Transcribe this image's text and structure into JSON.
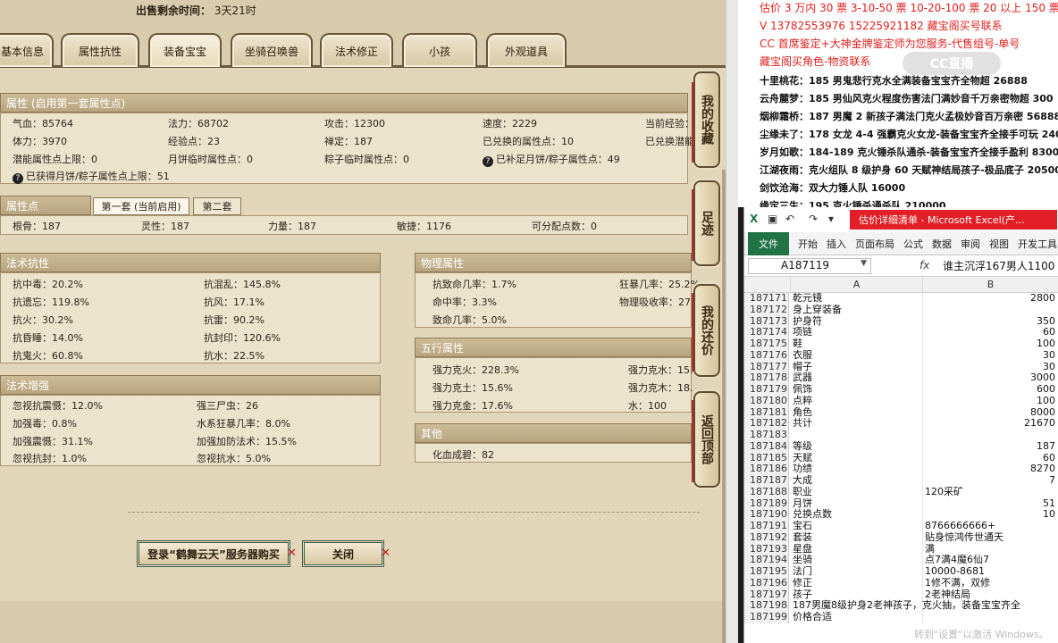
{
  "game": {
    "sale_time_label": "出售剩余时间：",
    "sale_time_value": "3天21时",
    "tabs": [
      "基本信息",
      "属性抗性",
      "装备宝宝",
      "坐骑召唤兽",
      "法术修正",
      "小孩",
      "外观道具"
    ],
    "active_tab": "装备宝宝",
    "attr_header": "属性 (启用第一套属性点)",
    "attrs": {
      "qixue": "气血：85764",
      "fali": "法力：68702",
      "gongji": "攻击：12300",
      "sudu": "速度：2229",
      "dangqian": "当前经验：",
      "tili": "体力：3970",
      "jingyan": "经验点：23",
      "chanding": "禅定：187",
      "yiduihuan": "已兑换的属性点：10",
      "yiduihuan_qian": "已兑换潜能",
      "qianneng": "潜能属性点上限：0",
      "yuebing": "月饼临时属性点：0",
      "zongzi": "粽子临时属性点：0",
      "yibuzu": "已补足月饼/粽子属性点：49",
      "yihuode": "已获得月饼/粽子属性点上限：51"
    },
    "shuxingdian_header": "属性点",
    "subtabs": [
      "第一套 (当前启用)",
      "第二套"
    ],
    "points": {
      "gengu": "根骨：187",
      "lingxing": "灵性：187",
      "liliang": "力量：187",
      "minjie": "敏捷：1176",
      "kefenpei": "可分配点数：0"
    },
    "fashu_kangxing_header": "法术抗性",
    "fashu_kangxing": [
      "抗中毒：20.2%",
      "抗混乱：145.8%",
      "抗遗忘：119.8%",
      "抗风：17.1%",
      "抗火：30.2%",
      "抗雷：90.2%",
      "抗昏睡：14.0%",
      "抗封印：120.6%",
      "抗鬼火：60.8%",
      "抗水：22.5%"
    ],
    "fashu_zengqiang_header": "法术增强",
    "fashu_zengqiang": [
      "忽视抗震慑：12.0%",
      "强三尸虫：26",
      "加强毒：0.8%",
      "水系狂暴几率：8.0%",
      "加强震慑：31.1%",
      "加强加防法术：15.5%",
      "忽视抗封：1.0%",
      "忽视抗水：5.0%"
    ],
    "wuli_header": "物理属性",
    "wuli": [
      "抗致命几率：1.7%",
      "狂暴几率：25.2%",
      "命中率：3.3%",
      "物理吸收率：27.",
      "致命几率：5.0%"
    ],
    "wuxing_header": "五行属性",
    "wuxing": [
      "强力克火：228.3%",
      "强力克水：15.",
      "强力克土：15.6%",
      "强力克木：18.",
      "强力克金：17.6%",
      "水：100"
    ],
    "qita_header": "其他",
    "qita": [
      "化血成碧：82"
    ],
    "side_buttons": [
      "我的收藏",
      "足迹",
      "我的还价",
      "返回顶部"
    ],
    "btn_login": "登录“鹤舞云天”服务器购买",
    "btn_close": "关闭"
  },
  "doc": {
    "lines": [
      "估价 3 万内 30 票  3-10-50 票  10-20-100 票  20 以上 150 票-1 票 1",
      "V 13782553976    15225921182   藏宝阁买号联系",
      "CC 首席鉴定+大神金牌鉴定师为您服务-代售组号-单号",
      "藏宝阁买角色-物资联系",
      "十里桃花：185 男鬼悲行克水全满装备宝宝齐全物超 26888",
      "云舟麓梦：185 男仙风克火程度伤害法门满妙音千万亲密物超 300",
      "烟柳霜桥：187 男魔 2 新孩子满法门克火孟极妙音百万亲密 56888",
      "尘缘未了：178 女龙 4-4 强霸克火女龙-装备宝宝齐全接手可玩 240",
      "岁月如歌：184-189 克火锤杀队通杀-装备宝宝齐全接手盈利 8300",
      "江湖夜雨：克火组队 8 级护身 60 天赋神结局孩子-极品底子 20500",
      "剑饮沧海：双大力锤人队 16000",
      "缘定三生：195 克火锤杀通杀队 210000"
    ],
    "watermark": "CC直播"
  },
  "excel": {
    "title": "估价详细清单 - Microsoft Excel(产...",
    "ribbon_tabs": [
      "文件",
      "开始",
      "插入",
      "页面布局",
      "公式",
      "数据",
      "审阅",
      "视图",
      "开发工具"
    ],
    "name_box": "A187119",
    "fx": "fx",
    "formula_value": "谁主沉浮167男人1100",
    "col_a": "A",
    "col_b": "B",
    "rows": [
      {
        "n": "187171",
        "a": "乾元镜",
        "b": "2800",
        "t": "num"
      },
      {
        "n": "187172",
        "a": "身上穿装备",
        "b": "",
        "t": "num"
      },
      {
        "n": "187173",
        "a": "护身符",
        "b": "350",
        "t": "num"
      },
      {
        "n": "187174",
        "a": "项链",
        "b": "60",
        "t": "num"
      },
      {
        "n": "187175",
        "a": "鞋",
        "b": "100",
        "t": "num"
      },
      {
        "n": "187176",
        "a": "衣服",
        "b": "30",
        "t": "num"
      },
      {
        "n": "187177",
        "a": "帽子",
        "b": "30",
        "t": "num"
      },
      {
        "n": "187178",
        "a": "武器",
        "b": "3000",
        "t": "num"
      },
      {
        "n": "187179",
        "a": "佩饰",
        "b": "600",
        "t": "num"
      },
      {
        "n": "187180",
        "a": "点粹",
        "b": "100",
        "t": "num"
      },
      {
        "n": "187181",
        "a": "角色",
        "b": "8000",
        "t": "num"
      },
      {
        "n": "187182",
        "a": "共计",
        "b": "21670",
        "t": "num"
      },
      {
        "n": "187183",
        "a": "",
        "b": "",
        "t": "num"
      },
      {
        "n": "187184",
        "a": "等级",
        "b": "187",
        "t": "num"
      },
      {
        "n": "187185",
        "a": "天赋",
        "b": "60",
        "t": "num"
      },
      {
        "n": "187186",
        "a": "功绩",
        "b": "8270",
        "t": "num"
      },
      {
        "n": "187187",
        "a": "大成",
        "b": "7",
        "t": "num"
      },
      {
        "n": "187188",
        "a": "职业",
        "b": "120采矿",
        "t": "text"
      },
      {
        "n": "187189",
        "a": "月饼",
        "b": "51",
        "t": "num"
      },
      {
        "n": "187190",
        "a": "兑换点数",
        "b": "10",
        "t": "num"
      },
      {
        "n": "187191",
        "a": "宝石",
        "b": "8766666666+",
        "t": "text"
      },
      {
        "n": "187192",
        "a": "套装",
        "b": "贴身惊鸿传世通天",
        "t": "text"
      },
      {
        "n": "187193",
        "a": "星盘",
        "b": "满",
        "t": "text"
      },
      {
        "n": "187194",
        "a": "坐骑",
        "b": "点7满4魔6仙7",
        "t": "text"
      },
      {
        "n": "187195",
        "a": "法门",
        "b": "10000-8681",
        "t": "text"
      },
      {
        "n": "187196",
        "a": "修正",
        "b": "1修不满，双修",
        "t": "text"
      },
      {
        "n": "187197",
        "a": "孩子",
        "b": "2老神结局",
        "t": "text"
      },
      {
        "n": "187198",
        "a": "187男魔8级护身2老神孩子，克火抽，装备宝宝齐全",
        "b": "",
        "t": "text"
      },
      {
        "n": "187199",
        "a": "价格合适",
        "b": "",
        "t": "text"
      }
    ],
    "watermark": "转到\"设置\"以激活 Windows。"
  }
}
